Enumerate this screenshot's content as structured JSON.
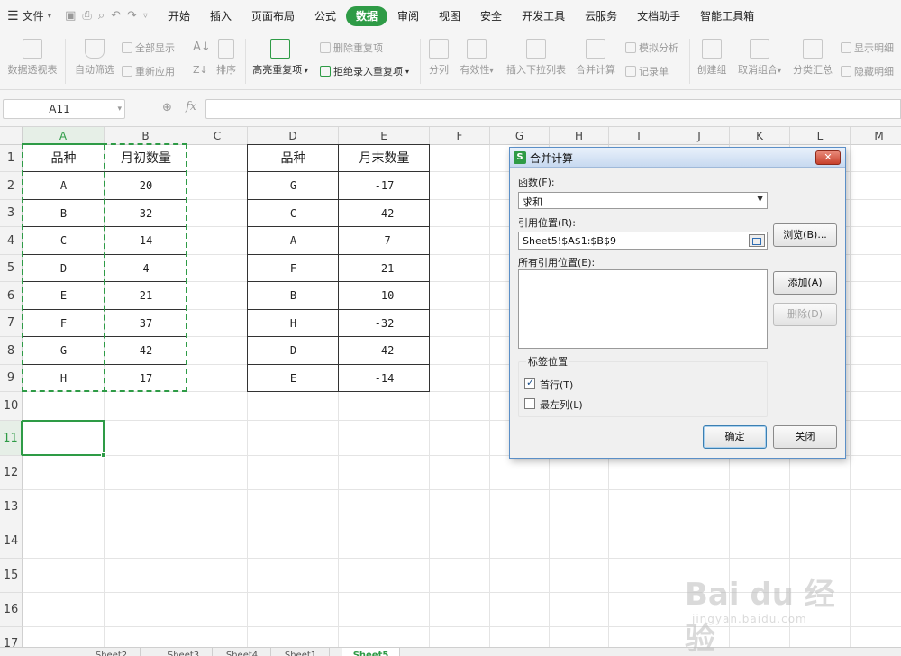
{
  "menubar": {
    "file_label": "文件",
    "tabs": [
      "开始",
      "插入",
      "页面布局",
      "公式",
      "数据",
      "审阅",
      "视图",
      "安全",
      "开发工具",
      "云服务",
      "文档助手",
      "智能工具箱"
    ],
    "active_tab": "数据",
    "accent_color": "#2e9b46"
  },
  "ribbon": {
    "pivot": "数据透视表",
    "autofilter": "自动筛选",
    "show_all": "全部显示",
    "reapply": "重新应用",
    "sort": "排序",
    "highlight_dup": "高亮重复项",
    "delete_dup": "删除重复项",
    "reject_dup": "拒绝录入重复项",
    "split": "分列",
    "validity": "有效性",
    "dropdown": "插入下拉列表",
    "consolidate": "合并计算",
    "simulate": "模拟分析",
    "record": "记录单",
    "group": "创建组",
    "ungroup": "取消组合",
    "subtotal": "分类汇总",
    "show_detail": "显示明细",
    "hide_detail": "隐藏明细"
  },
  "formula_bar": {
    "name_box": "A11",
    "fx_label": "fx",
    "formula": ""
  },
  "grid": {
    "columns": [
      "A",
      "B",
      "C",
      "D",
      "E",
      "F",
      "G",
      "H",
      "I",
      "J",
      "K",
      "L",
      "M"
    ],
    "rows": [
      "1",
      "2",
      "3",
      "4",
      "5",
      "6",
      "7",
      "8",
      "9",
      "10",
      "11",
      "12",
      "13",
      "14",
      "15",
      "16",
      "17"
    ],
    "selected_column": "A",
    "selected_row": "11",
    "table1": {
      "headers": [
        "品种",
        "月初数量"
      ],
      "rows": [
        [
          "A",
          "20"
        ],
        [
          "B",
          "32"
        ],
        [
          "C",
          "14"
        ],
        [
          "D",
          "4"
        ],
        [
          "E",
          "21"
        ],
        [
          "F",
          "37"
        ],
        [
          "G",
          "42"
        ],
        [
          "H",
          "17"
        ]
      ]
    },
    "table2": {
      "headers": [
        "品种",
        "月末数量"
      ],
      "rows": [
        [
          "G",
          "-17"
        ],
        [
          "C",
          "-42"
        ],
        [
          "A",
          "-7"
        ],
        [
          "F",
          "-21"
        ],
        [
          "B",
          "-10"
        ],
        [
          "H",
          "-32"
        ],
        [
          "D",
          "-42"
        ],
        [
          "E",
          "-14"
        ]
      ]
    }
  },
  "sheet_tabs": [
    "Sheet2",
    "Sheet3",
    "Sheet4",
    "Sheet1",
    "Sheet5"
  ],
  "active_sheet": "Sheet5",
  "dialog": {
    "title": "合并计算",
    "function_label": "函数(F):",
    "function_value": "求和",
    "ref_label": "引用位置(R):",
    "ref_value": "Sheet5!$A$1:$B$9",
    "browse_button": "浏览(B)...",
    "all_refs_label": "所有引用位置(E):",
    "add_button": "添加(A)",
    "delete_button": "删除(D)",
    "label_group": "标签位置",
    "first_row": "首行(T)",
    "first_row_checked": true,
    "left_col": "最左列(L)",
    "left_col_checked": false,
    "ok_button": "确定",
    "close_button": "关闭"
  },
  "watermark": {
    "logo": "Bai du 经验",
    "url": "jingyan.baidu.com"
  }
}
